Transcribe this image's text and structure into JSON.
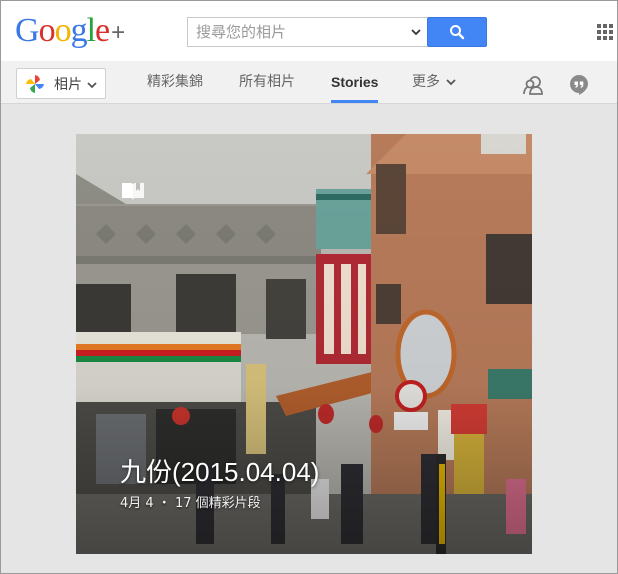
{
  "header": {
    "logo_letters": [
      "G",
      "o",
      "o",
      "g",
      "l",
      "e"
    ],
    "logo_plus": "+",
    "search": {
      "placeholder": "搜尋您的相片",
      "value": ""
    },
    "search_icon": "search-icon",
    "apps_icon": "apps-grid-icon"
  },
  "subnav": {
    "photos_button": {
      "label": "相片",
      "icon": "photos-pinwheel-icon"
    },
    "tabs": [
      {
        "label": "精彩集錦",
        "active": false
      },
      {
        "label": "所有相片",
        "active": false
      },
      {
        "label": "Stories",
        "active": true
      },
      {
        "label": "更多",
        "active": false
      }
    ],
    "right_icons": [
      "circles-icon",
      "hangouts-icon"
    ],
    "accent_color": "#4285f4"
  },
  "story": {
    "title": "九份(2015.04.04)",
    "subtitle": "4月 4 ・ 17 個精彩片段",
    "badge_icon": "book-icon"
  }
}
